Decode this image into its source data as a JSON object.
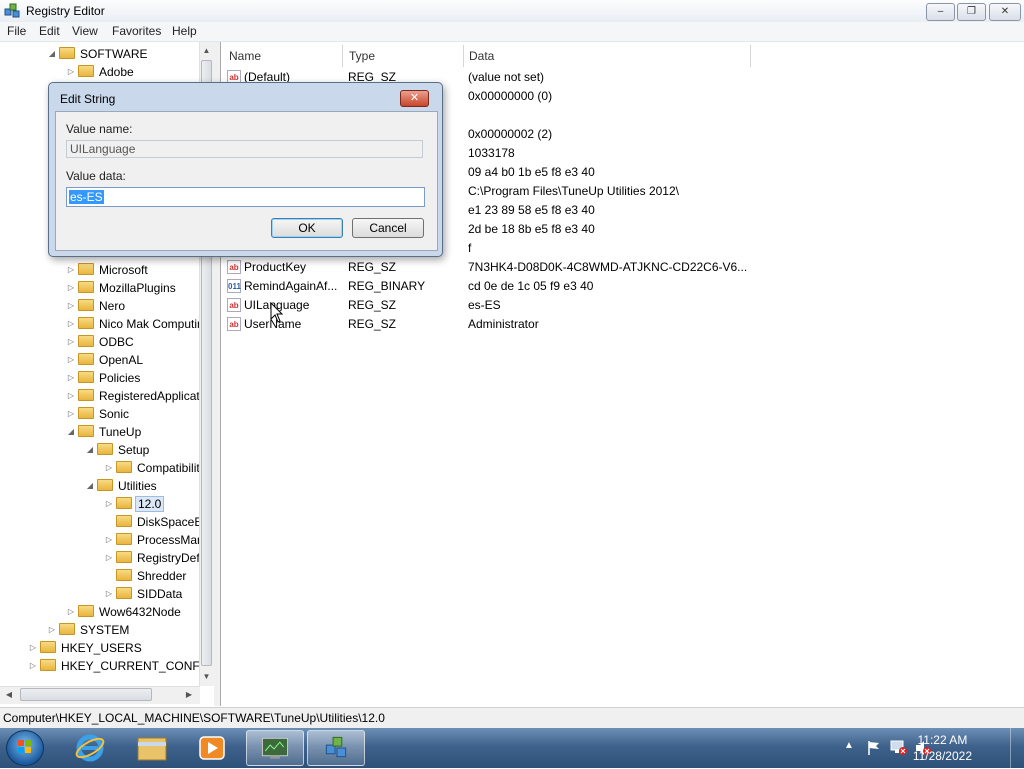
{
  "window": {
    "title": "Registry Editor"
  },
  "menu": [
    "File",
    "Edit",
    "View",
    "Favorites",
    "Help"
  ],
  "tree": [
    {
      "label": "SOFTWARE",
      "level": 2,
      "arrow": "down"
    },
    {
      "label": "Adobe",
      "level": 3,
      "arrow": "right"
    },
    {
      "label": "Microsoft",
      "level": 3,
      "arrow": "right"
    },
    {
      "label": "MozillaPlugins",
      "level": 3,
      "arrow": "right"
    },
    {
      "label": "Nero",
      "level": 3,
      "arrow": "right"
    },
    {
      "label": "Nico Mak Computing",
      "level": 3,
      "arrow": "right"
    },
    {
      "label": "ODBC",
      "level": 3,
      "arrow": "right"
    },
    {
      "label": "OpenAL",
      "level": 3,
      "arrow": "right"
    },
    {
      "label": "Policies",
      "level": 3,
      "arrow": "right"
    },
    {
      "label": "RegisteredApplications",
      "level": 3,
      "arrow": "right"
    },
    {
      "label": "Sonic",
      "level": 3,
      "arrow": "right"
    },
    {
      "label": "TuneUp",
      "level": 3,
      "arrow": "down"
    },
    {
      "label": "Setup",
      "level": 4,
      "arrow": "down"
    },
    {
      "label": "Compatibility",
      "level": 5,
      "arrow": "right"
    },
    {
      "label": "Utilities",
      "level": 4,
      "arrow": "down"
    },
    {
      "label": "12.0",
      "level": 5,
      "arrow": "right",
      "selected": true
    },
    {
      "label": "DiskSpaceExplorer",
      "level": 5,
      "arrow": ""
    },
    {
      "label": "ProcessManager",
      "level": 5,
      "arrow": "right"
    },
    {
      "label": "RegistryDefrag",
      "level": 5,
      "arrow": "right"
    },
    {
      "label": "Shredder",
      "level": 5,
      "arrow": ""
    },
    {
      "label": "SIDData",
      "level": 5,
      "arrow": "right"
    },
    {
      "label": "Wow6432Node",
      "level": 3,
      "arrow": "right"
    },
    {
      "label": "SYSTEM",
      "level": 2,
      "arrow": "right"
    },
    {
      "label": "HKEY_USERS",
      "level": 1,
      "arrow": "right"
    },
    {
      "label": "HKEY_CURRENT_CONFIG",
      "level": 1,
      "arrow": "right"
    }
  ],
  "list": {
    "columns": [
      "Name",
      "Type",
      "Data"
    ],
    "rows": [
      {
        "icon": "string",
        "name": "(Default)",
        "type": "REG_SZ",
        "data": "(value not set)"
      },
      {
        "icon": "",
        "name": "",
        "type": "",
        "data": "0x00000000 (0)"
      },
      {
        "icon": "",
        "name": "",
        "type": "",
        "data": ""
      },
      {
        "icon": "",
        "name": "",
        "type": "",
        "data": "0x00000002 (2)"
      },
      {
        "icon": "",
        "name": "",
        "type": "",
        "data": "1033178"
      },
      {
        "icon": "",
        "name": "",
        "type": "",
        "data": "09 a4 b0 1b e5 f8 e3 40"
      },
      {
        "icon": "",
        "name": "",
        "type": "",
        "data": "C:\\Program Files\\TuneUp Utilities 2012\\"
      },
      {
        "icon": "",
        "name": "",
        "type": "",
        "data": "e1 23 89 58 e5 f8 e3 40"
      },
      {
        "icon": "",
        "name": "",
        "type": "",
        "data": "2d be 18 8b e5 f8 e3 40"
      },
      {
        "icon": "",
        "name": "",
        "type": "",
        "data": "f"
      },
      {
        "icon": "string",
        "name": "ProductKey",
        "type": "REG_SZ",
        "data": "7N3HK4-D08D0K-4C8WMD-ATJKNC-CD22C6-V6..."
      },
      {
        "icon": "binary",
        "name": "RemindAgainAf...",
        "type": "REG_BINARY",
        "data": "cd 0e de 1c 05 f9 e3 40"
      },
      {
        "icon": "string",
        "name": "UILanguage",
        "type": "REG_SZ",
        "data": "es-ES"
      },
      {
        "icon": "string",
        "name": "UserName",
        "type": "REG_SZ",
        "data": "Administrator"
      }
    ]
  },
  "dialog": {
    "title": "Edit String",
    "value_name_label": "Value name:",
    "value_name": "UILanguage",
    "value_data_label": "Value data:",
    "value_data": "es-ES",
    "ok_label": "OK",
    "cancel_label": "Cancel"
  },
  "statusbar": {
    "path": "Computer\\HKEY_LOCAL_MACHINE\\SOFTWARE\\TuneUp\\Utilities\\12.0"
  },
  "taskbar": {
    "time": "11:22 AM",
    "date": "11/28/2022"
  },
  "icons": {
    "string_value": "ab",
    "binary_value": "011"
  }
}
